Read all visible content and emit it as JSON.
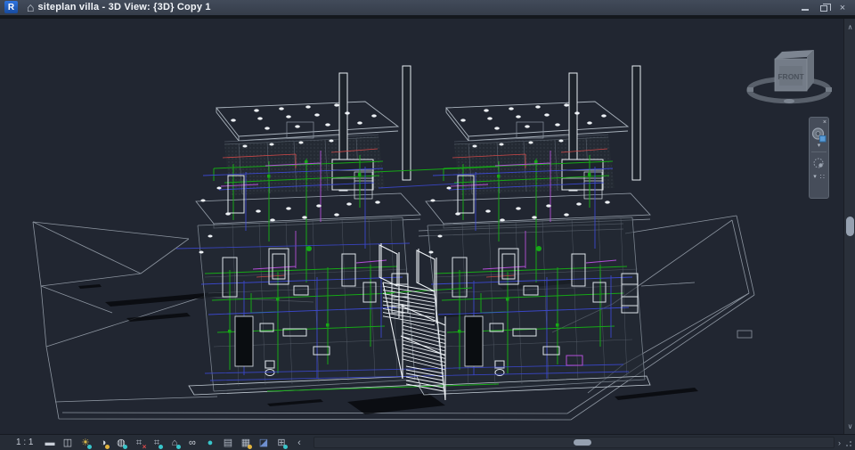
{
  "window": {
    "title": "siteplan villa - 3D View: {3D} Copy 1",
    "app_button_letter": "R",
    "home_icon_glyph": "⌂"
  },
  "viewcube": {
    "front_label": "FRONT"
  },
  "navigation_bar": {
    "close_glyph": "×",
    "caret_glyph": "▾",
    "grid_glyph": "∷"
  },
  "view_control_bar": {
    "scale_label": "1 : 1",
    "icons": [
      {
        "name": "detail-level-icon",
        "glyph": "▬",
        "color": "#c9cfd8",
        "accent": ""
      },
      {
        "name": "visual-style-icon",
        "glyph": "◫",
        "color": "#c9cfd8",
        "accent": ""
      },
      {
        "name": "sun-path-icon",
        "glyph": "☀",
        "color": "#d9b84a",
        "accent": "#38c6cb"
      },
      {
        "name": "shadows-icon",
        "glyph": "◑",
        "color": "#cfd5dd",
        "accent": "#e3b43d"
      },
      {
        "name": "show-rendering-dialog-icon",
        "glyph": "◍",
        "color": "#cfd5dd",
        "accent": "#38c6cb"
      },
      {
        "name": "crop-view-icon",
        "glyph": "⌗",
        "color": "#aeb6c2",
        "accent": "",
        "overlay_glyph": "×",
        "overlay_color": "#e14b4b"
      },
      {
        "name": "show-crop-region-icon",
        "glyph": "⌗",
        "color": "#aeb6c2",
        "accent": "#38c6cb"
      },
      {
        "name": "unlocked-3d-view-icon",
        "glyph": "⌂",
        "color": "#b9c1cc",
        "accent": "#38c6cb"
      },
      {
        "name": "temporary-hide-isolate-icon",
        "glyph": "∞",
        "color": "#cfd5dd",
        "accent": ""
      },
      {
        "name": "reveal-hidden-elements-icon",
        "glyph": "●",
        "color": "#38c6cb",
        "accent": ""
      },
      {
        "name": "temporary-view-properties-icon",
        "glyph": "▤",
        "color": "#aeb6c2",
        "accent": ""
      },
      {
        "name": "analytical-model-icon",
        "glyph": "▦",
        "color": "#aeb6c2",
        "accent": "#e3b43d"
      },
      {
        "name": "displacement-sets-icon",
        "glyph": "◪",
        "color": "#6f8fd0",
        "accent": ""
      },
      {
        "name": "reveal-constraints-icon",
        "glyph": "⊞",
        "color": "#aeb6c2",
        "accent": "#38c6cb"
      },
      {
        "name": "view-bar-collapse-chevron",
        "glyph": "‹",
        "color": "#aeb6c2",
        "accent": ""
      }
    ]
  },
  "scrollbars": {
    "up_glyph": "∧",
    "down_glyph": "∨",
    "right_glyph": "›"
  },
  "colors": {
    "viewport_background": "#212631",
    "titlebar": "#3a4250",
    "app_accent_blue": "#1f5fd6",
    "pipe_green": "#16a816",
    "pipe_blue": "#3c49d4",
    "pipe_violet": "#b44fd8",
    "pipe_red": "#cf4848",
    "wire_gray": "#8d96a1",
    "wire_bright": "#e8edf2",
    "accent_teal": "#38c6cb",
    "accent_yellow": "#e3b43d"
  }
}
